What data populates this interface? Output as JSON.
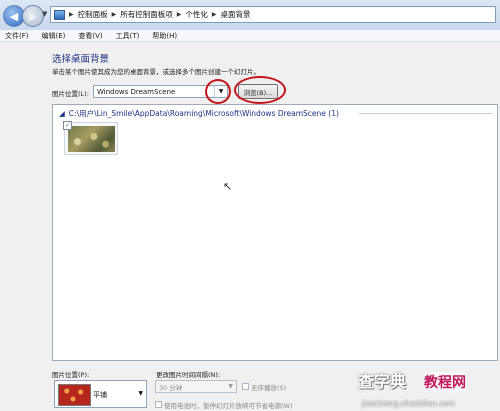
{
  "address_bar": {
    "breadcrumbs": [
      "控制面板",
      "所有控制面板项",
      "个性化",
      "桌面背景"
    ]
  },
  "menu": [
    "文件(F)",
    "编辑(E)",
    "查看(V)",
    "工具(T)",
    "帮助(H)"
  ],
  "header": {
    "title": "选择桌面背景",
    "subtitle": "单击某个图片使其成为您的桌面背景，或选择多个图片创建一个幻灯片。"
  },
  "location": {
    "label": "图片位置(L):",
    "value": "Windows DreamScene",
    "browse_label": "浏览(B)..."
  },
  "list": {
    "group_path": "C:\\用户\\Lin_Smile\\AppData\\Roaming\\Microsoft\\Windows DreamScene (1)"
  },
  "bottom": {
    "position_label": "图片位置(P):",
    "position_value": "平铺",
    "interval_label": "更改图片时间间隔(N):",
    "interval_value": "30 分钟",
    "shuffle_label": "无序播放(S)",
    "battery_label": "使用电池时，暂停幻灯片放映可节省电源(W)"
  },
  "watermark": {
    "site": "查字典",
    "brand": "教程网",
    "url": "jiaocheng.chazidian.com"
  },
  "colors": {
    "annotation": "#c4161c",
    "title": "#1e3287"
  }
}
